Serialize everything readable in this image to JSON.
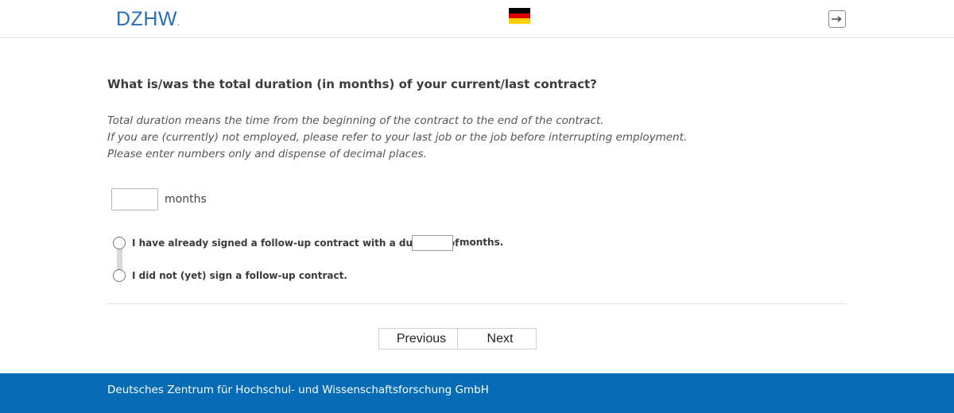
{
  "header": {
    "logo_text": "DZHW",
    "logo_dot": ".",
    "language_flag": "germany-flag-icon",
    "logout_icon": "logout-icon",
    "colors": {
      "logo": "#2a6db5",
      "flag_black": "#000000",
      "flag_red": "#dd0000",
      "flag_gold": "#ffce00"
    }
  },
  "question": {
    "title": "What is/was the total duration (in months) of your current/last contract?",
    "instructions": [
      "Total duration means the time from the beginning of the contract to the end of the contract.",
      "If you are (currently) not employed, please refer to your last job or the job before interrupting employment.",
      "Please enter numbers only and dispense of decimal places."
    ]
  },
  "duration": {
    "value": "",
    "unit_label": "months"
  },
  "options": {
    "followup_signed": {
      "label": "I have already signed a follow-up contract with a duration of",
      "value": "",
      "suffix": "months.",
      "selected": false
    },
    "not_signed": {
      "label": "I did not (yet) sign a follow-up contract.",
      "selected": false
    }
  },
  "navigation": {
    "previous_label": "Previous",
    "next_label": "Next"
  },
  "footer": {
    "text": "Deutsches Zentrum für Hochschul- und Wissenschaftsforschung GmbH",
    "color": "#056cb5"
  }
}
